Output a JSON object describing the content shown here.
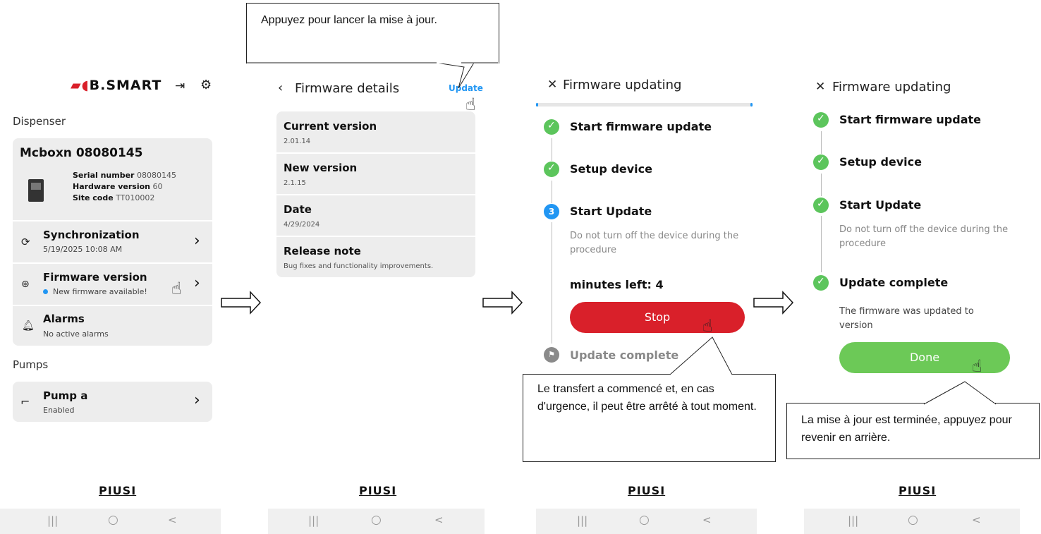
{
  "screen1": {
    "logo": "B.SMART",
    "section_dispenser": "Dispenser",
    "dispenser_name": "Mcboxn 08080145",
    "serial_label": "Serial number",
    "serial_value": "08080145",
    "hw_label": "Hardware version",
    "hw_value": "60",
    "site_label": "Site code",
    "site_value": "TT010002",
    "sync_title": "Synchronization",
    "sync_sub": "5/19/2025 10:08 AM",
    "fw_title": "Firmware version",
    "fw_sub": "New firmware available!",
    "alarms_title": "Alarms",
    "alarms_sub": "No active alarms",
    "section_pumps": "Pumps",
    "pump_title": "Pump a",
    "pump_sub": "Enabled",
    "icons": [
      "logout-icon",
      "gear-icon",
      "sync-icon",
      "chip-icon",
      "bell-icon",
      "nozzle-icon",
      "chevron-right-icon",
      "hand-pointer-icon"
    ]
  },
  "screen2": {
    "header": "Firmware details",
    "update_label": "Update",
    "current_title": "Current version",
    "current_value": "2.01.14",
    "new_title": "New version",
    "new_value": "2.1.15",
    "date_title": "Date",
    "date_value": "4/29/2024",
    "release_title": "Release note",
    "release_value": "Bug fixes and functionality improvements."
  },
  "screen3": {
    "header": "Firmware updating",
    "step1": "Start firmware update",
    "step2": "Setup device",
    "step3_num": "3",
    "step3": "Start Update",
    "step3_desc": "Do not turn off the device during the procedure",
    "minutes": "minutes left: 4",
    "stop_label": "Stop",
    "step4": "Update complete"
  },
  "screen4": {
    "header": "Firmware updating",
    "step1": "Start firmware update",
    "step2": "Setup device",
    "step3": "Start Update",
    "step3_desc": "Do not turn off the device during the procedure",
    "step4": "Update complete",
    "step4_desc": "The firmware was updated to version",
    "done_label": "Done"
  },
  "callouts": {
    "update": "Appuyez pour lancer la mise à jour.",
    "stop": "Le transfert a commencé et, en cas d'urgence, il peut être arrêté à tout moment.",
    "done": "La mise à jour est terminée, appuyez pour revenir en arrière."
  },
  "brand": "PIUSI",
  "nav": {
    "recent": "|||",
    "home": "○",
    "back": "<"
  },
  "colors": {
    "accent_blue": "#2196f3",
    "stop_red": "#d9202a",
    "done_green": "#6cc957",
    "check_green": "#5cc55c",
    "card_grey": "#ededed"
  }
}
